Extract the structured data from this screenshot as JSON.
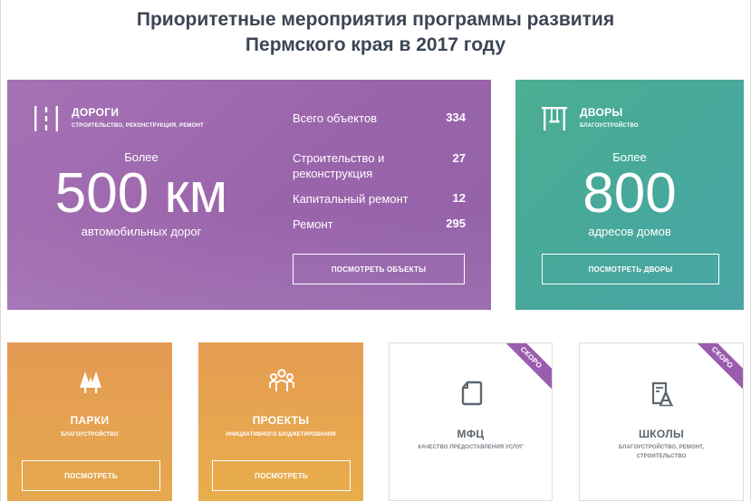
{
  "page": {
    "title_line1": "Приоритетные мероприятия программы развития",
    "title_line2": "Пермского края в 2017 году"
  },
  "roads": {
    "icon": "road-icon",
    "title": "ДОРОГИ",
    "subtitle": "СТРОИТЕЛЬСТВО, РЕКОНСТРУКЦИЯ, РЕМОНТ",
    "pre": "Более",
    "number": "500 км",
    "unit": "автомобильных дорог",
    "stats": [
      {
        "label": "Всего объектов",
        "value": "334"
      },
      {
        "label": "Строительство и реконструкция",
        "value": "27"
      },
      {
        "label": "Капитальный ремонт",
        "value": "12"
      },
      {
        "label": "Ремонт",
        "value": "295"
      }
    ],
    "button": "ПОСМОТРЕТЬ ОБЪЕКТЫ"
  },
  "yards": {
    "icon": "courtyard-icon",
    "title": "ДВОРЫ",
    "subtitle": "БЛАГОУСТРОЙСТВО",
    "pre": "Более",
    "number": "800",
    "unit": "адресов домов",
    "button": "ПОСМОТРЕТЬ ДВОРЫ"
  },
  "parks": {
    "icon": "trees-icon",
    "title": "ПАРКИ",
    "subtitle": "БЛАГОУСТРОЙСТВО",
    "button": "ПОСМОТРЕТЬ"
  },
  "projects": {
    "icon": "people-icon",
    "title": "ПРОЕКТЫ",
    "subtitle": "ИНИЦИАТИВНОГО БЮДЖЕТИРОВАНИЯ",
    "button": "ПОСМОТРЕТЬ"
  },
  "mfc": {
    "icon": "document-icon",
    "title": "МФЦ",
    "subtitle": "КАЧЕСТВО ПРЕДОСТАВЛЕНИЯ УСЛУГ",
    "ribbon": "СКОРО"
  },
  "schools": {
    "icon": "school-book-icon",
    "title": "ШКОЛЫ",
    "subtitle_line1": "БЛАГОУСТРОЙСТВО, РЕМОНТ,",
    "subtitle_line2": "СТРОИТЕЛЬСТВО",
    "ribbon": "СКОРО"
  },
  "colors": {
    "roads": "#9b65ad",
    "yards": "#49aa98",
    "orange": "#e6a350",
    "ribbon": "#9a5cae",
    "title": "#3c4654"
  }
}
